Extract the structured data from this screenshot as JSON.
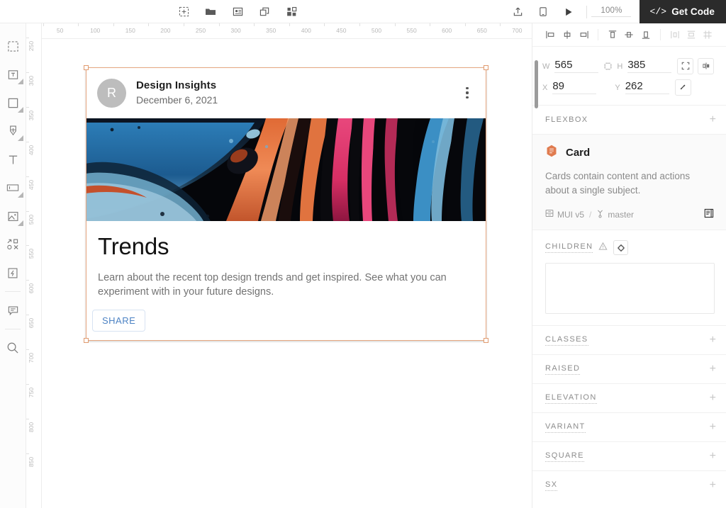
{
  "topbar": {
    "tools": [
      {
        "name": "add-artboard-icon"
      },
      {
        "name": "folder-icon"
      },
      {
        "name": "image-icon"
      },
      {
        "name": "duplicate-icon"
      },
      {
        "name": "components-icon"
      }
    ],
    "publish_icon": "publish-icon",
    "preview_device_icon": "device-preview-icon",
    "play_icon": "play-icon",
    "zoom": "100%",
    "get_code_label": "Get Code"
  },
  "left_tools": [
    {
      "name": "select-marquee-icon",
      "sub": false
    },
    {
      "name": "text-box-icon",
      "sub": true
    },
    {
      "name": "rectangle-icon",
      "sub": true
    },
    {
      "name": "pen-icon",
      "sub": true
    },
    {
      "name": "text-icon",
      "sub": false
    },
    {
      "name": "input-field-icon",
      "sub": true
    },
    {
      "name": "image-placeholder-icon",
      "sub": true
    },
    {
      "name": "components-grid-icon",
      "sub": false
    },
    {
      "name": "interactions-icon",
      "sub": false
    },
    {
      "name": "comment-icon",
      "sub": false
    },
    {
      "name": "search-icon",
      "sub": false
    }
  ],
  "rulers": {
    "horizontal": [
      50,
      100,
      150,
      200,
      250,
      300,
      350,
      400,
      450,
      500,
      550,
      600,
      650,
      700
    ],
    "vertical": [
      250,
      300,
      350,
      400,
      450,
      500,
      550,
      600,
      650,
      700,
      750,
      800,
      850
    ],
    "vertical_partial_top": "2"
  },
  "card": {
    "avatar_letter": "R",
    "title": "Design Insights",
    "date": "December 6, 2021",
    "menu_icon": "more-vertical-icon",
    "media_alt": "abstract-paint-swirl-image",
    "heading": "Trends",
    "description": "Learn about the recent top design trends and get inspired. See what you can experiment with in your future designs.",
    "share_label": "SHARE"
  },
  "inspector": {
    "align_icons": [
      {
        "name": "align-left-icon",
        "dim": false
      },
      {
        "name": "align-center-horizontal-icon",
        "dim": false
      },
      {
        "name": "align-right-icon",
        "dim": false
      },
      {
        "name": "align-top-icon",
        "dim": false
      },
      {
        "name": "align-middle-vertical-icon",
        "dim": false
      },
      {
        "name": "align-bottom-icon",
        "dim": false
      },
      {
        "name": "distribute-horizontal-icon",
        "dim": true
      },
      {
        "name": "distribute-vertical-icon",
        "dim": true
      },
      {
        "name": "distribute-grid-icon",
        "dim": true
      }
    ],
    "size": {
      "w_label": "W",
      "w_value": "565",
      "h_label": "H",
      "h_value": "385",
      "x_label": "X",
      "x_value": "89",
      "y_label": "Y",
      "y_value": "262",
      "constrain_icon": "constrain-proportions-icon",
      "fit_icon": "fit-content-icon",
      "flip_icon": "flip-horizontal-icon",
      "rotate_icon": "rotate-icon"
    },
    "flexbox_label": "FLEXBOX",
    "component": {
      "icon": "component-badge-icon",
      "name": "Card",
      "description": "Cards contain content and actions about a single subject.",
      "library": "MUI v5",
      "separator": "/",
      "branch": "master",
      "library_icon": "library-icon",
      "branch_icon": "branch-icon",
      "docs_icon": "documentation-icon"
    },
    "children": {
      "label": "CHILDREN",
      "warning_icon": "warning-triangle-icon",
      "reset_icon": "reset-circle-icon"
    },
    "sections": [
      {
        "label": "CLASSES",
        "add": "+"
      },
      {
        "label": "RAISED",
        "add": "+"
      },
      {
        "label": "ELEVATION",
        "add": "+"
      },
      {
        "label": "VARIANT",
        "add": "+"
      },
      {
        "label": "SQUARE",
        "add": "+"
      },
      {
        "label": "SX",
        "add": "+"
      }
    ],
    "add_symbol": "+"
  },
  "colors": {
    "accent_dark": "#2b2b2b",
    "selection": "#e09a6e",
    "component_badge": "#e07b4f",
    "share_blue": "#4d83c4"
  }
}
